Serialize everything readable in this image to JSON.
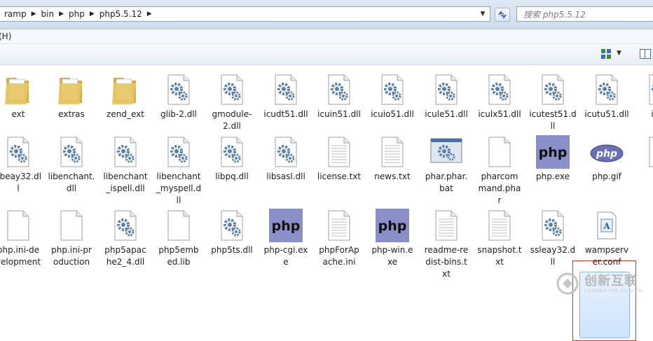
{
  "address": {
    "crumbs": [
      "ramp",
      "bin",
      "php",
      "php5.5.12"
    ]
  },
  "search": {
    "placeholder": "搜索 php5.5.12"
  },
  "menu": {
    "fragment": "(H)"
  },
  "files": [
    {
      "name": "ext",
      "type": "folder"
    },
    {
      "name": "extras",
      "type": "folder"
    },
    {
      "name": "zend_ext",
      "type": "folder"
    },
    {
      "name": "glib-2.dll",
      "type": "dll"
    },
    {
      "name": "gmodule-2.dll",
      "type": "dll"
    },
    {
      "name": "icudt51.dll",
      "type": "dll"
    },
    {
      "name": "icuin51.dll",
      "type": "dll"
    },
    {
      "name": "icuio51.dll",
      "type": "dll"
    },
    {
      "name": "icule51.dll",
      "type": "dll"
    },
    {
      "name": "iculx51.dll",
      "type": "dll"
    },
    {
      "name": "icutest51.dll",
      "type": "dll"
    },
    {
      "name": "icutu51.dll",
      "type": "dll"
    },
    {
      "name": "icuu",
      "type": "dll"
    },
    {
      "name": "libeay32.dll",
      "type": "dll"
    },
    {
      "name": "libenchant.dll",
      "type": "dll"
    },
    {
      "name": "libenchant_ispell.dll",
      "type": "dll"
    },
    {
      "name": "libenchant_myspell.dll",
      "type": "dll"
    },
    {
      "name": "libpq.dll",
      "type": "dll"
    },
    {
      "name": "libsasl.dll",
      "type": "dll"
    },
    {
      "name": "license.txt",
      "type": "txt"
    },
    {
      "name": "news.txt",
      "type": "txt"
    },
    {
      "name": "phar.phar.bat",
      "type": "bat"
    },
    {
      "name": "pharcommand.phar",
      "type": "blank"
    },
    {
      "name": "php.exe",
      "type": "phpexe"
    },
    {
      "name": "php.gif",
      "type": "phpgif"
    },
    {
      "name": "ph",
      "type": "blank"
    },
    {
      "name": "php.ini-development",
      "type": "blank"
    },
    {
      "name": "php.ini-production",
      "type": "blank"
    },
    {
      "name": "php5apache2_4.dll",
      "type": "dll"
    },
    {
      "name": "php5embed.lib",
      "type": "blank"
    },
    {
      "name": "php5ts.dll",
      "type": "dll"
    },
    {
      "name": "php-cgi.exe",
      "type": "phpexe"
    },
    {
      "name": "phpForApache.ini",
      "type": "txt"
    },
    {
      "name": "php-win.exe",
      "type": "phpexe"
    },
    {
      "name": "readme-redist-bins.txt",
      "type": "txt"
    },
    {
      "name": "snapshot.txt",
      "type": "txt"
    },
    {
      "name": "ssleay32.dll",
      "type": "dll"
    },
    {
      "name": "wampserver.conf",
      "type": "conf"
    }
  ],
  "labels": {
    "r0": [
      "ext",
      "extras",
      "zend_ext",
      "glib-2.dll",
      "gmodule-\n2.dll",
      "icudt51.dll",
      "icuin51.dll",
      "icuio51.dll",
      "icule51.dll",
      "iculx51.dll",
      "icutest51.d\nll",
      "icutu51.dll",
      "icuu"
    ],
    "r1": [
      "libeay32.dl\nl",
      "libenchant.\ndll",
      "libenchant\n_ispell.dll",
      "libenchant\n_myspell.d\nll",
      "libpq.dll",
      "libsasl.dll",
      "license.txt",
      "news.txt",
      "phar.phar.\nbat",
      "pharcom\nmand.pha\nr",
      "php.exe",
      "php.gif",
      "ph"
    ],
    "r2": [
      "php.ini-de\nvelopment",
      "php.ini-pr\noduction",
      "php5apac\nhe2_4.dll",
      "php5emb\ned.lib",
      "php5ts.dll",
      "php-cgi.ex\ne",
      "phpForAp\nache.ini",
      "php-win.e\nxe",
      "readme-re\ndist-bins.t\nxt",
      "snapshot.t\nxt",
      "ssleay32.d\nll",
      "wampserv\ner.conf"
    ]
  },
  "watermark": {
    "cn": "创新互联",
    "en": "CHUANG XIN HU LIAN"
  },
  "colors": {
    "folder": "#e8c664",
    "gear": "#5a7fa9",
    "php_bg": "#8a8fc7",
    "selection_border": "#d9342b",
    "selected_fill": "#cfe3fb"
  }
}
